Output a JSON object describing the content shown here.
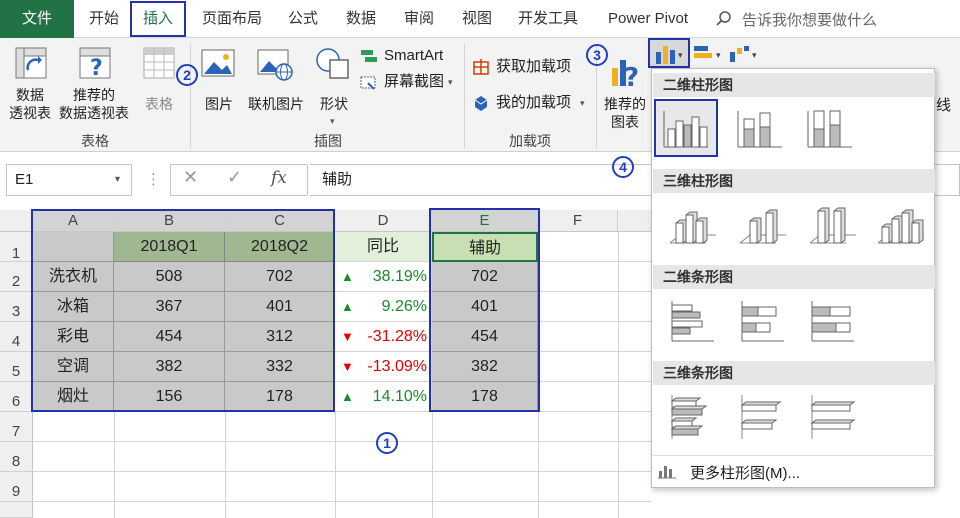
{
  "tabs": {
    "file": "文件",
    "home": "开始",
    "insert": "插入",
    "layout": "页面布局",
    "formula": "公式",
    "data": "数据",
    "review": "审阅",
    "view": "视图",
    "dev": "开发工具",
    "pivot": "Power Pivot",
    "search_placeholder": "告诉我你想要做什么"
  },
  "ribbon": {
    "pivot_table": [
      "数据",
      "透视表"
    ],
    "recommended_pivot": [
      "推荐的",
      "数据透视表"
    ],
    "table": "表格",
    "group_table": "表格",
    "picture": "图片",
    "online_picture": "联机图片",
    "shapes": "形状",
    "smartart": "SmartArt",
    "screenshot": "屏幕截图",
    "group_illustration": "插图",
    "get_addins": "获取加载项",
    "my_addins": "我的加载项",
    "group_addins": "加载项",
    "recommended_chart": [
      "推荐的",
      "图表"
    ],
    "line_partial": "线"
  },
  "formula_bar": {
    "name_box": "E1",
    "content": "辅助",
    "fx": "fx"
  },
  "grid": {
    "columns": [
      "A",
      "B",
      "C",
      "D",
      "E",
      "F"
    ],
    "rows": [
      "1",
      "2",
      "3",
      "4",
      "5",
      "6",
      "7",
      "8",
      "9"
    ],
    "header": [
      "",
      "2018Q1",
      "2018Q2",
      "同比",
      "辅助"
    ],
    "data": [
      {
        "name": "洗衣机",
        "q1": "508",
        "q2": "702",
        "dir": "▲",
        "pct": "38.19%",
        "aux": "702"
      },
      {
        "name": "冰箱",
        "q1": "367",
        "q2": "401",
        "dir": "▲",
        "pct": "9.26%",
        "aux": "401"
      },
      {
        "name": "彩电",
        "q1": "454",
        "q2": "312",
        "dir": "▼",
        "pct": "-31.28%",
        "aux": "454"
      },
      {
        "name": "空调",
        "q1": "382",
        "q2": "332",
        "dir": "▼",
        "pct": "-13.09%",
        "aux": "382"
      },
      {
        "name": "烟灶",
        "q1": "156",
        "q2": "178",
        "dir": "▲",
        "pct": "14.10%",
        "aux": "178"
      }
    ]
  },
  "steps": {
    "s1": "1",
    "s2": "2",
    "s3": "3",
    "s4": "4"
  },
  "menu": {
    "sec1": "二维柱形图",
    "sec2": "三维柱形图",
    "sec3": "二维条形图",
    "sec4": "三维条形图",
    "more": "更多柱形图(M)..."
  },
  "colors": {
    "file_tab": "#217346",
    "insert_tab_text": "#217346",
    "header_fill": "#9fb892",
    "data_fill": "#c9c9c9",
    "aux_header_fill": "#c6e0b4",
    "up_green": "#1a8a2a",
    "down_red": "#e00000",
    "annotation_blue": "#1f3fbf"
  }
}
